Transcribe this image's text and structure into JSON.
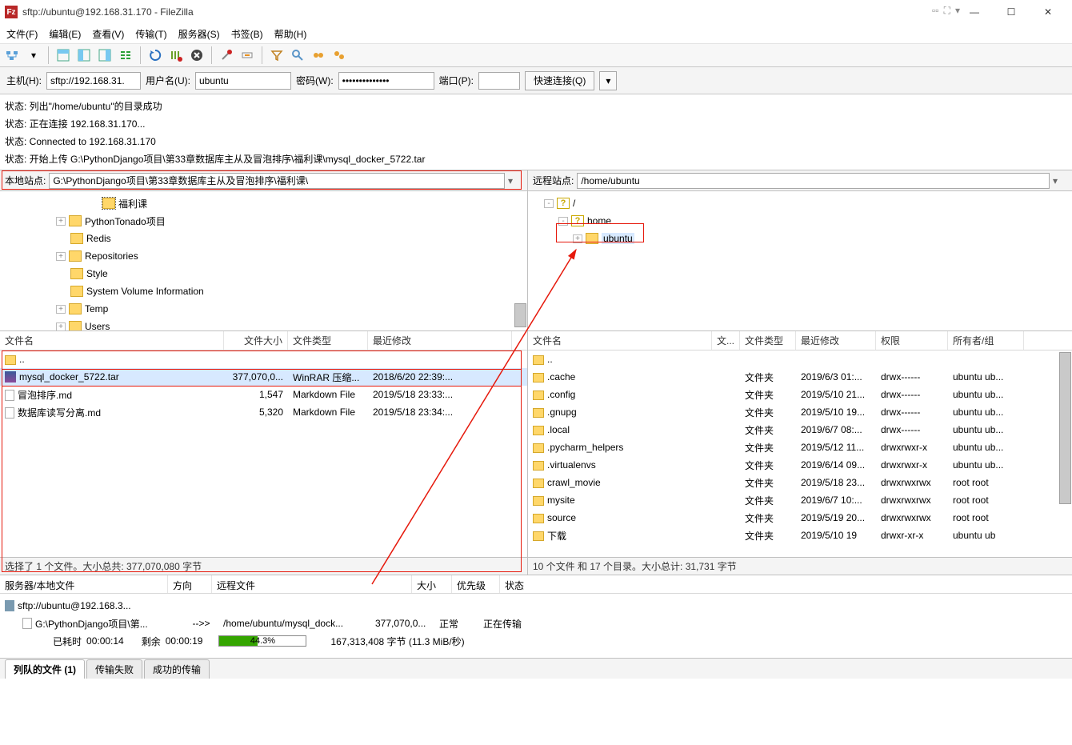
{
  "title": "sftp://ubuntu@192.168.31.170 - FileZilla",
  "menu": [
    "文件(F)",
    "编辑(E)",
    "查看(V)",
    "传输(T)",
    "服务器(S)",
    "书签(B)",
    "帮助(H)"
  ],
  "conn": {
    "host_lbl": "主机(H):",
    "host": "sftp://192.168.31.",
    "user_lbl": "用户名(U):",
    "user": "ubuntu",
    "pass_lbl": "密码(W):",
    "pass": "••••••••••••••",
    "port_lbl": "端口(P):",
    "port": "",
    "quick": "快速连接(Q)"
  },
  "log": [
    "状态:  列出\"/home/ubuntu\"的目录成功",
    "状态:  正在连接 192.168.31.170...",
    "状态:  Connected to 192.168.31.170",
    "状态:  开始上传 G:\\PythonDjango项目\\第33章数据库主从及冒泡排序\\福利课\\mysql_docker_5722.tar"
  ],
  "local": {
    "site_lbl": "本地站点:",
    "path": "G:\\PythonDjango项目\\第33章数据库主从及冒泡排序\\福利课\\",
    "tree": [
      {
        "name": "福利课",
        "indent": 110,
        "exp": "",
        "sel": true
      },
      {
        "name": "PythonTonado项目",
        "indent": 70,
        "exp": "+"
      },
      {
        "name": "Redis",
        "indent": 70,
        "exp": ""
      },
      {
        "name": "Repositories",
        "indent": 70,
        "exp": "+"
      },
      {
        "name": "Style",
        "indent": 70,
        "exp": ""
      },
      {
        "name": "System Volume Information",
        "indent": 70,
        "exp": ""
      },
      {
        "name": "Temp",
        "indent": 70,
        "exp": "+"
      },
      {
        "name": "Users",
        "indent": 70,
        "exp": "+"
      }
    ],
    "cols": {
      "name": "文件名",
      "size": "文件大小",
      "type": "文件类型",
      "mod": "最近修改"
    },
    "cw": {
      "name": 280,
      "size": 80,
      "type": 100,
      "mod": 180
    },
    "rows": [
      {
        "name": "..",
        "folder": true
      },
      {
        "name": "mysql_docker_5722.tar",
        "size": "377,070,0...",
        "type": "WinRAR 压缩...",
        "mod": "2018/6/20 22:39:...",
        "sel": true,
        "icon": "rar"
      },
      {
        "name": "冒泡排序.md",
        "size": "1,547",
        "type": "Markdown File",
        "mod": "2019/5/18 23:33:..."
      },
      {
        "name": "数据库读写分离.md",
        "size": "5,320",
        "type": "Markdown File",
        "mod": "2019/5/18 23:34:..."
      }
    ],
    "status": "选择了 1 个文件。大小总共: 377,070,080 字节"
  },
  "remote": {
    "site_lbl": "远程站点:",
    "path": "/home/ubuntu",
    "tree": [
      {
        "name": "/",
        "indent": 10,
        "exp": "-",
        "q": true
      },
      {
        "name": "home",
        "indent": 28,
        "exp": "-",
        "q": true
      },
      {
        "name": "ubuntu",
        "indent": 46,
        "exp": "+",
        "sel": true
      }
    ],
    "cols": {
      "name": "文件名",
      "size": "文...",
      "type": "文件类型",
      "mod": "最近修改",
      "perm": "权限",
      "owner": "所有者/组"
    },
    "cw": {
      "name": 230,
      "size": 35,
      "type": 70,
      "mod": 100,
      "perm": 90,
      "owner": 95
    },
    "rows": [
      {
        "name": "..",
        "folder": true
      },
      {
        "name": ".cache",
        "type": "文件夹",
        "mod": "2019/6/3 01:...",
        "perm": "drwx------",
        "owner": "ubuntu ub...",
        "folder": true
      },
      {
        "name": ".config",
        "type": "文件夹",
        "mod": "2019/5/10 21...",
        "perm": "drwx------",
        "owner": "ubuntu ub...",
        "folder": true
      },
      {
        "name": ".gnupg",
        "type": "文件夹",
        "mod": "2019/5/10 19...",
        "perm": "drwx------",
        "owner": "ubuntu ub...",
        "folder": true
      },
      {
        "name": ".local",
        "type": "文件夹",
        "mod": "2019/6/7 08:...",
        "perm": "drwx------",
        "owner": "ubuntu ub...",
        "folder": true
      },
      {
        "name": ".pycharm_helpers",
        "type": "文件夹",
        "mod": "2019/5/12 11...",
        "perm": "drwxrwxr-x",
        "owner": "ubuntu ub...",
        "folder": true
      },
      {
        "name": ".virtualenvs",
        "type": "文件夹",
        "mod": "2019/6/14 09...",
        "perm": "drwxrwxr-x",
        "owner": "ubuntu ub...",
        "folder": true
      },
      {
        "name": "crawl_movie",
        "type": "文件夹",
        "mod": "2019/5/18 23...",
        "perm": "drwxrwxrwx",
        "owner": "root root",
        "folder": true
      },
      {
        "name": "mysite",
        "type": "文件夹",
        "mod": "2019/6/7 10:...",
        "perm": "drwxrwxrwx",
        "owner": "root root",
        "folder": true
      },
      {
        "name": "source",
        "type": "文件夹",
        "mod": "2019/5/19 20...",
        "perm": "drwxrwxrwx",
        "owner": "root root",
        "folder": true
      },
      {
        "name": "下载",
        "type": "文件夹",
        "mod": "2019/5/10 19",
        "perm": "drwxr-xr-x",
        "owner": "ubuntu ub",
        "folder": true
      }
    ],
    "status": "10 个文件 和 17 个目录。大小总计: 31,731 字节"
  },
  "queue": {
    "cols": {
      "server": "服务器/本地文件",
      "dir": "方向",
      "remote": "远程文件",
      "size": "大小",
      "prio": "优先级",
      "status": "状态"
    },
    "cw": {
      "server": 210,
      "dir": 55,
      "remote": 250,
      "size": 50,
      "prio": 60,
      "status": 100
    },
    "server_line": "sftp://ubuntu@192.168.3...",
    "local_file": "G:\\PythonDjango项目\\第...",
    "dir_arrow": "-->>",
    "remote_file": "/home/ubuntu/mysql_dock...",
    "size": "377,070,0...",
    "prio": "正常",
    "status": "正在传输",
    "elapsed_lbl": "已耗时",
    "elapsed": "00:00:14",
    "left_lbl": "剩余",
    "left": "00:00:19",
    "percent": "44.3%",
    "pct_val": 44.3,
    "transferred": "167,313,408 字节 (11.3 MiB/秒)"
  },
  "tabs": {
    "queued": "列队的文件 (1)",
    "failed": "传输失败",
    "success": "成功的传输"
  }
}
